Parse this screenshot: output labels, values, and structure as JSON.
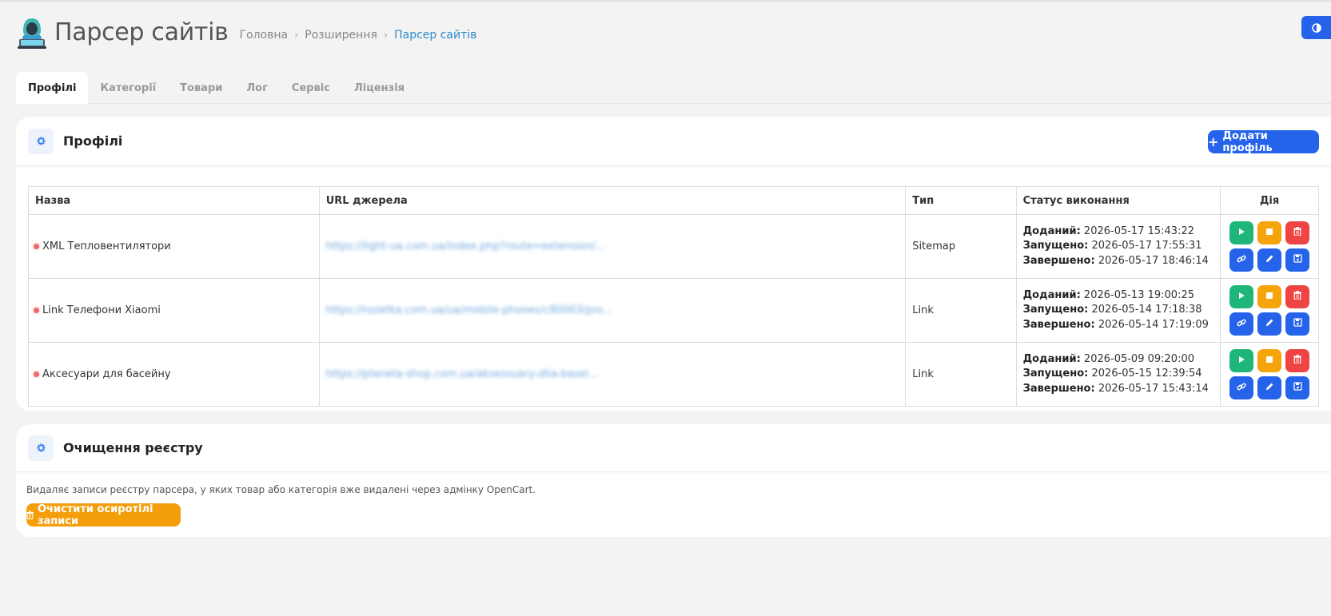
{
  "header": {
    "title": "Парсер сайтів",
    "breadcrumb": [
      "Головна",
      "Розширення",
      "Парсер сайтів"
    ]
  },
  "tabs": [
    "Профілі",
    "Категорії",
    "Товари",
    "Лог",
    "Сервіс",
    "Ліцензія"
  ],
  "profiles_panel": {
    "title": "Профілі",
    "add_button": "Додати профіль",
    "columns": [
      "Назва",
      "URL джерела",
      "Тип",
      "Статус виконання",
      "Дія"
    ],
    "rows": [
      {
        "name": "XML Тепловентилятори",
        "url": "https://light-ua.com.ua/index.php?route=extension/...",
        "type": "Sitemap",
        "added_label": "Доданий:",
        "added": "2026-05-17 15:43:22",
        "started_label": "Запущено:",
        "started": "2026-05-17 17:55:31",
        "finished_label": "Завершено:",
        "finished": "2026-05-17 18:46:14"
      },
      {
        "name": "Link Телефони Xiaomi",
        "url": "https://rozetka.com.ua/ua/mobile-phones/c80003/pro...",
        "type": "Link",
        "added_label": "Доданий:",
        "added": "2026-05-13 19:00:25",
        "started_label": "Запущено:",
        "started": "2026-05-14 17:18:38",
        "finished_label": "Завершено:",
        "finished": "2026-05-14 17:19:09"
      },
      {
        "name": "Аксесуари для басейну",
        "url": "https://planeta-shop.com.ua/aksessuary-dlia-basei...",
        "type": "Link",
        "added_label": "Доданий:",
        "added": "2026-05-09 09:20:00",
        "started_label": "Запущено:",
        "started": "2026-05-15 12:39:54",
        "finished_label": "Завершено:",
        "finished": "2026-05-17 15:43:14"
      }
    ]
  },
  "cleanup_panel": {
    "title": "Очищення реєстру",
    "description": "Видаляє записи реєстру парсера, у яких товар або категорія вже видалені через адмінку OpenCart.",
    "button": "Очистити осиротілі записи"
  },
  "colors": {
    "accent": "#2563eb",
    "run": "#1fb67a",
    "stop": "#f5a40c",
    "delete": "#ef4444",
    "status_dot": "#f06a6a"
  }
}
